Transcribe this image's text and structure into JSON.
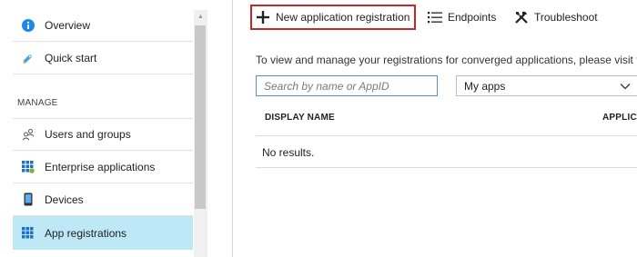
{
  "sidebar": {
    "items": [
      {
        "label": "Overview",
        "icon": "info-icon"
      },
      {
        "label": "Quick start",
        "icon": "quickstart-icon"
      },
      {
        "label": "Users and groups",
        "icon": "users-icon"
      },
      {
        "label": "Enterprise applications",
        "icon": "enterprise-apps-icon"
      },
      {
        "label": "Devices",
        "icon": "device-icon"
      },
      {
        "label": "App registrations",
        "icon": "app-registrations-icon"
      }
    ],
    "section_header": "MANAGE",
    "active_item": "App registrations"
  },
  "toolbar": {
    "new_label": "New application registration",
    "endpoints_label": "Endpoints",
    "troubleshoot_label": "Troubleshoot"
  },
  "main": {
    "intro_text": "To view and manage your registrations for converged applications, please visit t",
    "search_placeholder": "Search by name or AppID",
    "filter_selected": "My apps",
    "columns": [
      "DISPLAY NAME",
      "APPLICA"
    ],
    "empty_text": "No results."
  },
  "colors": {
    "accent_blue": "#0078d4",
    "active_bg": "#bfe8f7",
    "highlight_border": "#c62828"
  }
}
